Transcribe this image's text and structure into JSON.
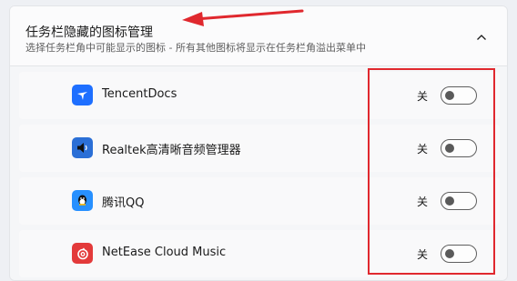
{
  "section": {
    "title": "任务栏隐藏的图标管理",
    "subtitle": "选择任务栏角中可能显示的图标 - 所有其他图标将显示在任务栏角溢出菜单中"
  },
  "items": [
    {
      "name": "TencentDocs",
      "state": "关",
      "icon": "tencent-docs-icon",
      "icon_color": "#1e6fff"
    },
    {
      "name": "Realtek高清晰音频管理器",
      "state": "关",
      "icon": "speaker-icon",
      "icon_color": "#2b6fd6"
    },
    {
      "name": "腾讯QQ",
      "state": "关",
      "icon": "qq-penguin-icon",
      "icon_color": "#2790ff"
    },
    {
      "name": "NetEase Cloud Music",
      "state": "关",
      "icon": "netease-music-icon",
      "icon_color": "#e33a3a"
    }
  ],
  "colors": {
    "annotation": "#e0282e"
  }
}
